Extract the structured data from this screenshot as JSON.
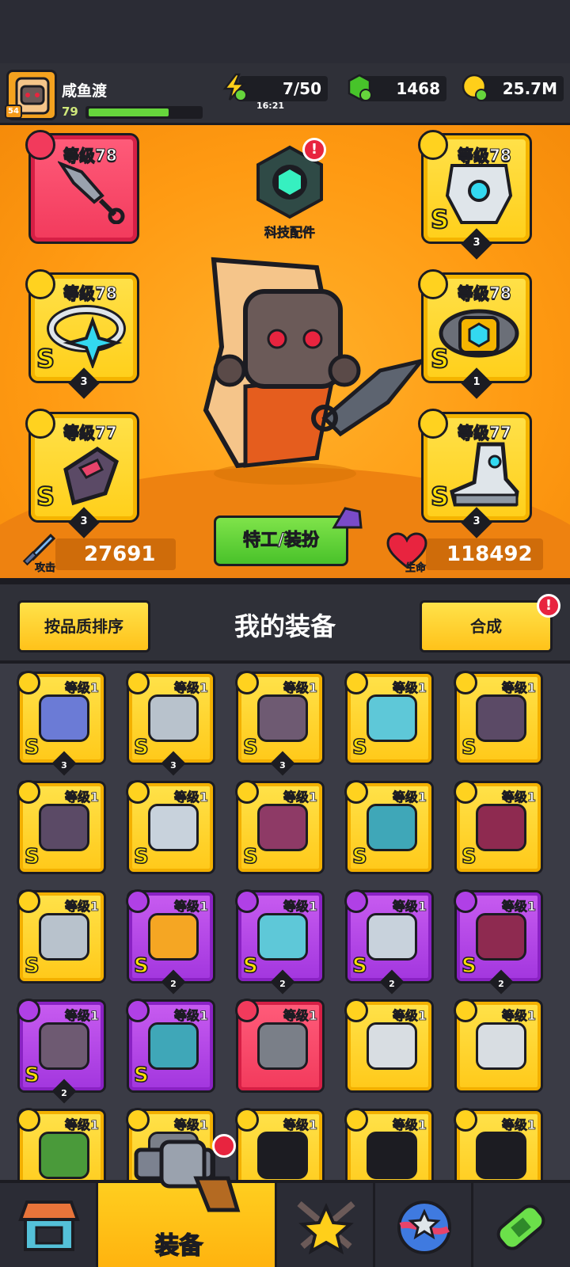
{
  "player": {
    "name": "咸鱼渡",
    "account_level": "54",
    "level": "79",
    "xp_fraction": 0.72
  },
  "resources": {
    "energy": "7/50",
    "energy_timer": "16:21",
    "gems": "1468",
    "coins": "25.7M"
  },
  "tech": {
    "label": "科技配件",
    "alert": "!"
  },
  "slots": [
    {
      "level": "等级78",
      "rarity_color": "red",
      "grade": "",
      "stars": "",
      "icon": "weapon-icon"
    },
    {
      "level": "等级78",
      "rarity_color": "gold",
      "grade": "S",
      "stars": "3",
      "icon": "armor-icon"
    },
    {
      "level": "等级78",
      "rarity_color": "gold",
      "grade": "S",
      "stars": "3",
      "icon": "necklace-icon"
    },
    {
      "level": "等级78",
      "rarity_color": "gold",
      "grade": "S",
      "stars": "1",
      "icon": "belt-icon"
    },
    {
      "level": "等级77",
      "rarity_color": "gold",
      "grade": "S",
      "stars": "3",
      "icon": "glove-icon"
    },
    {
      "level": "等级77",
      "rarity_color": "gold",
      "grade": "S",
      "stars": "3",
      "icon": "boot-icon"
    }
  ],
  "stats": {
    "attack_label": "攻击",
    "attack": "27691",
    "hp_label": "生命",
    "hp": "118492"
  },
  "agent_button": "特工/装扮",
  "equipment": {
    "sort_button": "按品质排序",
    "title": "我的装备",
    "merge_button": "合成",
    "merge_alert": "!",
    "items": [
      {
        "level": "等级1",
        "rarity": "gold",
        "grade": "S",
        "stars": "3",
        "icon": "weapon-icon",
        "color": "#6b7bd6"
      },
      {
        "level": "等级1",
        "rarity": "gold",
        "grade": "S",
        "stars": "3",
        "icon": "glove-icon",
        "color": "#b8c2cc"
      },
      {
        "level": "等级1",
        "rarity": "gold",
        "grade": "S",
        "stars": "3",
        "icon": "boot-icon",
        "color": "#6e5a72"
      },
      {
        "level": "等级1",
        "rarity": "gold",
        "grade": "S",
        "stars": "",
        "icon": "armor-icon",
        "color": "#5ec8d8"
      },
      {
        "level": "等级1",
        "rarity": "gold",
        "grade": "S",
        "stars": "",
        "icon": "armor-icon",
        "color": "#5b4a66"
      },
      {
        "level": "等级1",
        "rarity": "gold",
        "grade": "S",
        "stars": "",
        "icon": "armor-icon",
        "color": "#5b4a66"
      },
      {
        "level": "等级1",
        "rarity": "gold",
        "grade": "S",
        "stars": "",
        "icon": "necklace-icon",
        "color": "#c8d2dc"
      },
      {
        "level": "等级1",
        "rarity": "gold",
        "grade": "S",
        "stars": "",
        "icon": "necklace-icon",
        "color": "#8e3a66"
      },
      {
        "level": "等级1",
        "rarity": "gold",
        "grade": "S",
        "stars": "",
        "icon": "belt-icon",
        "color": "#3fa7b8"
      },
      {
        "level": "等级1",
        "rarity": "gold",
        "grade": "S",
        "stars": "",
        "icon": "belt-icon",
        "color": "#8e2a50"
      },
      {
        "level": "等级1",
        "rarity": "gold",
        "grade": "S",
        "stars": "",
        "icon": "glove-icon",
        "color": "#b8c2cc"
      },
      {
        "level": "等级1",
        "rarity": "purple",
        "grade": "S",
        "stars": "2",
        "icon": "weapon-icon",
        "color": "#f5a623"
      },
      {
        "level": "等级1",
        "rarity": "purple",
        "grade": "S",
        "stars": "2",
        "icon": "armor-icon",
        "color": "#5ec8d8"
      },
      {
        "level": "等级1",
        "rarity": "purple",
        "grade": "S",
        "stars": "2",
        "icon": "necklace-icon",
        "color": "#c8d2dc"
      },
      {
        "level": "等级1",
        "rarity": "purple",
        "grade": "S",
        "stars": "2",
        "icon": "belt-icon",
        "color": "#8e2a50"
      },
      {
        "level": "等级1",
        "rarity": "purple",
        "grade": "S",
        "stars": "2",
        "icon": "boot-icon",
        "color": "#6e5a72"
      },
      {
        "level": "等级1",
        "rarity": "purple",
        "grade": "S",
        "stars": "",
        "icon": "belt-icon",
        "color": "#3fa7b8"
      },
      {
        "level": "等级1",
        "rarity": "red",
        "grade": "",
        "stars": "",
        "icon": "belt-icon",
        "color": "#7a7f88"
      },
      {
        "level": "等级1",
        "rarity": "gold",
        "grade": "",
        "stars": "",
        "icon": "weapon-icon",
        "color": "#d8dde2"
      },
      {
        "level": "等级1",
        "rarity": "gold",
        "grade": "",
        "stars": "",
        "icon": "weapon-icon",
        "color": "#d8dde2"
      },
      {
        "level": "等级1",
        "rarity": "gold",
        "grade": "",
        "stars": "",
        "icon": "armor-icon",
        "color": "#4a9a3a"
      },
      {
        "level": "等级1",
        "rarity": "gold",
        "grade": "",
        "stars": "",
        "icon": "armor-icon",
        "color": "#7a7f88"
      },
      {
        "level": "等级1",
        "rarity": "gold",
        "grade": "",
        "stars": "",
        "icon": "necklace-icon",
        "color": "#1c1c22"
      },
      {
        "level": "等级1",
        "rarity": "gold",
        "grade": "",
        "stars": "",
        "icon": "necklace-icon",
        "color": "#1c1c22"
      },
      {
        "level": "等级1",
        "rarity": "gold",
        "grade": "",
        "stars": "",
        "icon": "necklace-icon",
        "color": "#1c1c22"
      }
    ]
  },
  "nav": {
    "active_label": "装备"
  }
}
